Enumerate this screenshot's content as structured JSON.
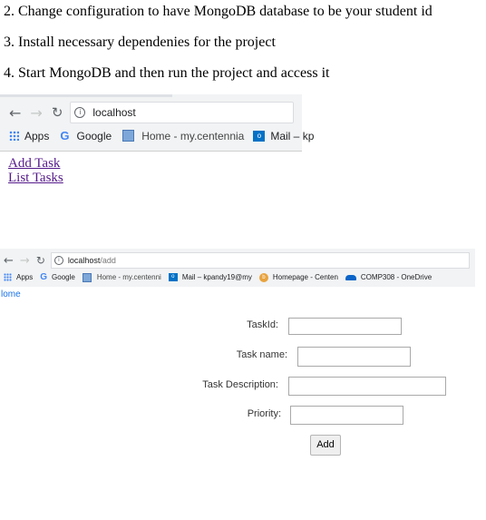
{
  "steps": [
    "2. Change configuration to have MongoDB database to be your student id",
    "3. Install necessary dependenies for the project",
    "4. Start MongoDB and then run the project and access it"
  ],
  "browser1": {
    "url": "localhost",
    "bookmarks": [
      "Apps",
      "Google",
      "Home - my.centennia",
      "Mail – kp"
    ],
    "links": [
      "Add Task",
      "List Tasks"
    ]
  },
  "browser2": {
    "url_host": "localhost",
    "url_path": "/add",
    "bookmarks": [
      "Apps",
      "Google",
      "Home - my.centenni",
      "Mail – kpandy19@my",
      "Homepage - Centen",
      "COMP308 - OneDrive"
    ],
    "home_link": "lome"
  },
  "form": {
    "fields": [
      {
        "label": "TaskId:"
      },
      {
        "label": "Task name:"
      },
      {
        "label": "Task Description:"
      },
      {
        "label": "Priority:"
      }
    ],
    "submit_label": "Add"
  },
  "colors": {
    "link": "#551a8b",
    "link_blue": "#1a73e8",
    "toolbar": "#f1f3f4"
  }
}
